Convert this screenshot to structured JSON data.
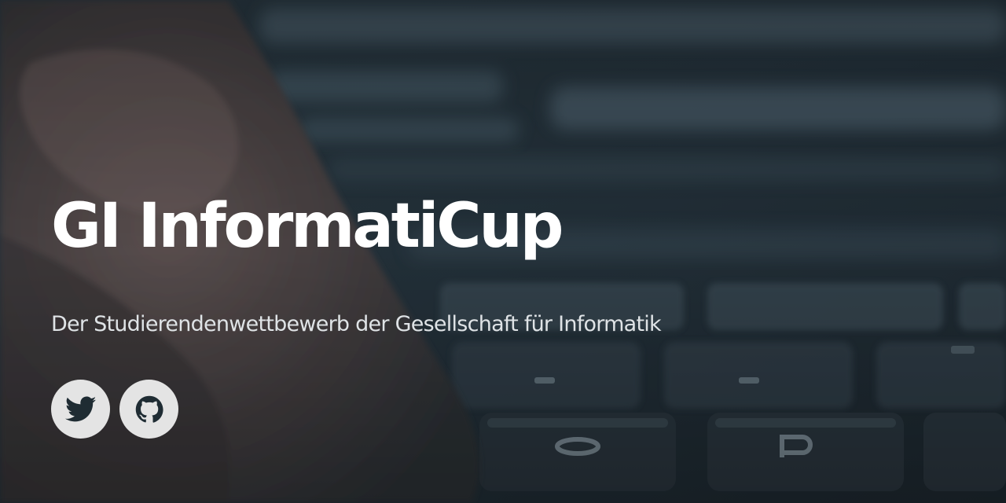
{
  "hero": {
    "title": "GI InformatiCup",
    "subtitle": "Der Studierendenwettbewerb der Gesellschaft für Informatik"
  },
  "social_links": [
    {
      "icon": "twitter-icon"
    },
    {
      "icon": "github-icon"
    }
  ],
  "colors": {
    "title_text": "#ffffff",
    "subtitle_text": "#dfe3e6",
    "button_bg": "#e4e4e4",
    "icon": "#1f2c33",
    "background_dark": "#1f2c36"
  }
}
